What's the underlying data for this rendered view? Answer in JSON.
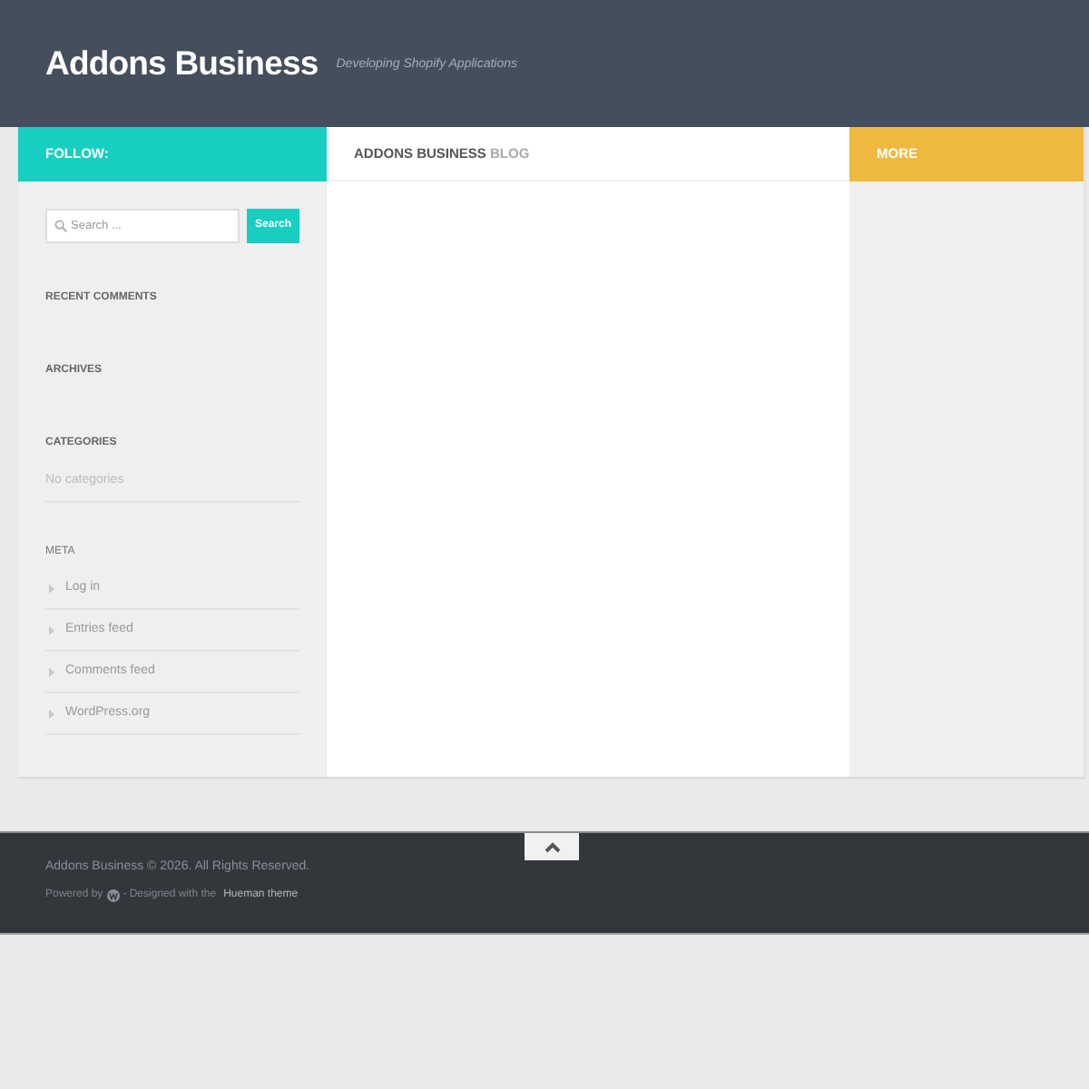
{
  "header": {
    "site_title": "Addons Business",
    "tagline": "Developing Shopify Applications"
  },
  "left_sidebar": {
    "heading": "FOLLOW:",
    "search": {
      "placeholder": "Search ...",
      "button": "Search"
    },
    "widgets": [
      {
        "kind": "empty",
        "title": "RECENT COMMENTS"
      },
      {
        "kind": "empty",
        "title": "ARCHIVES"
      },
      {
        "kind": "note",
        "title": "CATEGORIES",
        "note": "No categories"
      },
      {
        "kind": "links",
        "title": "META",
        "links": [
          "Log in",
          "Entries feed",
          "Comments feed",
          "WordPress.org"
        ]
      }
    ]
  },
  "main": {
    "heading": "ADDONS BUSINESS",
    "heading_suffix": "BLOG"
  },
  "right_sidebar": {
    "heading": "MORE"
  },
  "footer": {
    "copyright": "Addons Business © 2026. All Rights Reserved.",
    "powered_by": "Powered by",
    "designed_with": "- Designed with the",
    "theme_link": "Hueman theme"
  }
}
